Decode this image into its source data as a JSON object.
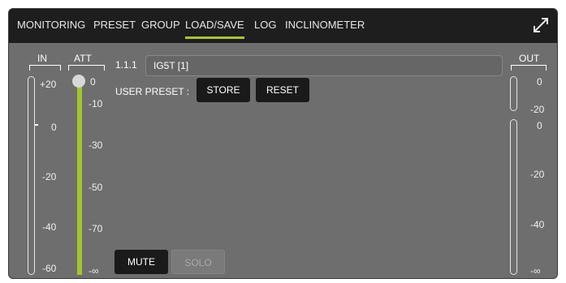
{
  "tabs": [
    {
      "label": "MONITORING"
    },
    {
      "label": "PRESET"
    },
    {
      "label": "GROUP"
    },
    {
      "label": "LOAD/SAVE",
      "active": true
    },
    {
      "label": "LOG"
    },
    {
      "label": "INCLINOMETER"
    }
  ],
  "input_meter": {
    "label": "IN",
    "scale": [
      "+20",
      "0",
      "-20",
      "-40",
      "-60"
    ]
  },
  "attenuation": {
    "label": "ATT",
    "scale": [
      "0",
      "-10",
      "-30",
      "-50",
      "-70",
      "-∞"
    ],
    "value": "0"
  },
  "output_meter": {
    "label": "OUT",
    "top_scale": [
      "0",
      "-20"
    ],
    "scale": [
      "0",
      "-20",
      "-40",
      "-∞"
    ]
  },
  "preset": {
    "id": "1.1.1",
    "name": "IG5T [1]",
    "user_preset_label": "USER PRESET :",
    "store_label": "STORE",
    "reset_label": "RESET"
  },
  "controls": {
    "mute_label": "MUTE",
    "solo_label": "SOLO"
  },
  "colors": {
    "accent": "#a9c630",
    "topbar": "#1e1e1e",
    "panel": "#6e6e6e"
  },
  "icons": {
    "expand": "expand-icon"
  }
}
